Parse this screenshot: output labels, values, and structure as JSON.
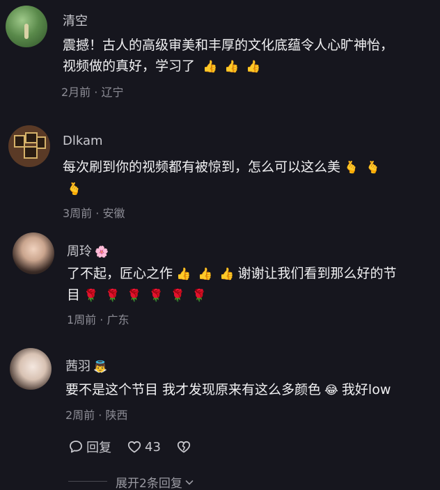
{
  "comments": [
    {
      "name": "清空",
      "badge": "",
      "lines": [
        "震撼！古人的高级审美和丰厚的文化底蕴令人心旷神怡，",
        "视频做的真好，学习了"
      ],
      "emojis": [
        "👍",
        "👍",
        "👍"
      ],
      "meta": "2月前 · 辽宁"
    },
    {
      "name": "Dlkam",
      "badge": "",
      "lines": [
        "每次刷到你的视频都有被惊到，怎么可以这么美"
      ],
      "emojis": [
        "🫰",
        "🫰",
        "🫰"
      ],
      "meta": "3周前 · 安徽"
    },
    {
      "name": "周玲",
      "badge": "🌸",
      "lines": [
        "了不起，匠心之作",
        "谢谢让我们看到那么好的节",
        "目"
      ],
      "emojis": [
        "👍",
        "👍",
        "👍"
      ],
      "emojis2": [
        "🌹",
        "🌹",
        "🌹",
        "🌹",
        "🌹",
        "🌹"
      ],
      "meta": "1周前 · 广东"
    },
    {
      "name": "茜羽",
      "badge": "👼",
      "lines": [
        "要不是这个节目 我才发现原来有这么多颜色",
        "我好low"
      ],
      "emojis": [
        "😂"
      ],
      "meta": "2周前 · 陕西"
    }
  ],
  "actions": {
    "reply_label": "回复",
    "like_count": "43"
  },
  "expand_label": "展开2条回复"
}
